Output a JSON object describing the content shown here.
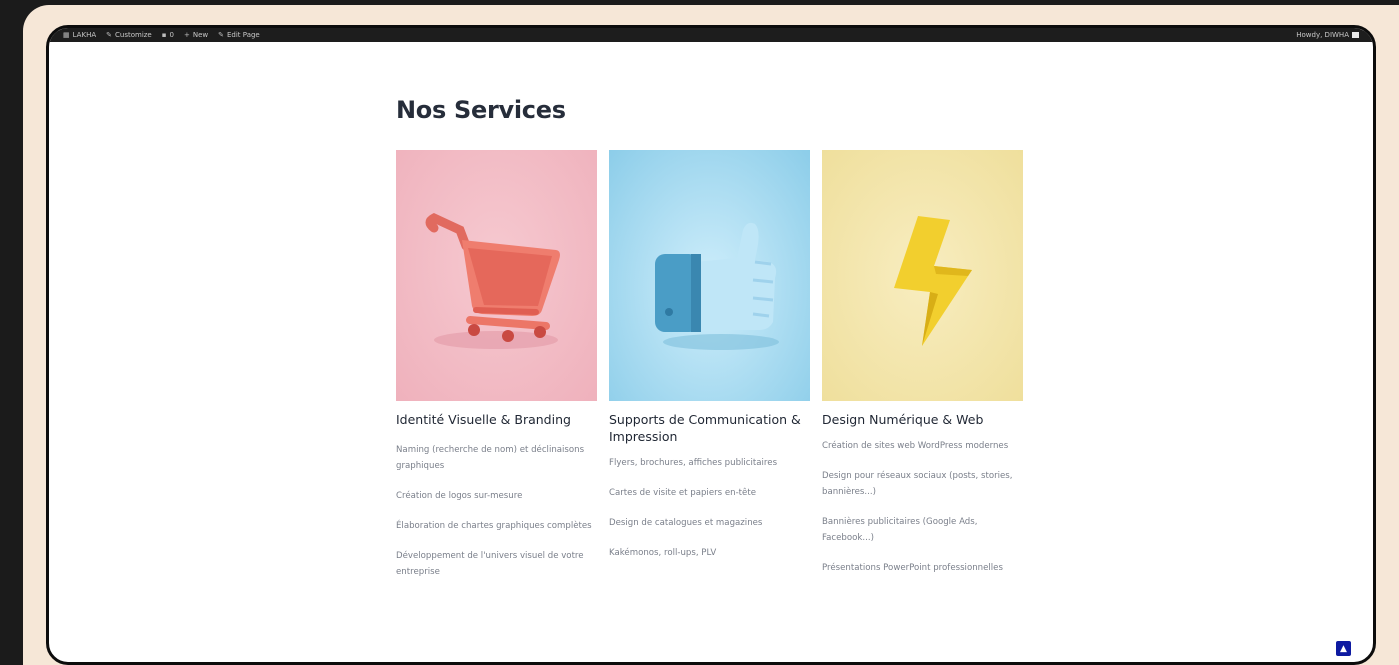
{
  "adminbar": {
    "site": "LAKHA",
    "customize": "Customize",
    "comments": "0",
    "new": "New",
    "edit": "Edit Page",
    "howdy": "Howdy, DIWHA"
  },
  "page": {
    "title": "Nos Services"
  },
  "services": [
    {
      "title": "Identité Visuelle & Branding",
      "icon": "shopping-cart-icon",
      "bg": "#f2bcc4",
      "items": [
        "Naming (recherche de nom) et déclinaisons graphiques",
        "Création de logos sur-mesure",
        "Élaboration de chartes graphiques complètes",
        "Développement de l'univers visuel de votre entreprise"
      ]
    },
    {
      "title": "Supports de Communication & Impression",
      "icon": "thumbs-up-icon",
      "bg": "#8fd0ee",
      "items": [
        "Flyers, brochures, affiches publicitaires",
        "Cartes de visite et papiers en-tête",
        "Design de catalogues et magazines",
        "Kakémonos, roll-ups, PLV"
      ]
    },
    {
      "title": "Design Numérique & Web",
      "icon": "lightning-bolt-icon",
      "bg": "#f3e3a3",
      "items": [
        "Création de sites web WordPress modernes",
        "Design pour réseaux sociaux (posts, stories, bannières...)",
        "Bannières publicitaires (Google Ads, Facebook...)",
        "Présentations PowerPoint professionnelles"
      ]
    }
  ],
  "scroll_top_icon": "chevron-up-icon"
}
